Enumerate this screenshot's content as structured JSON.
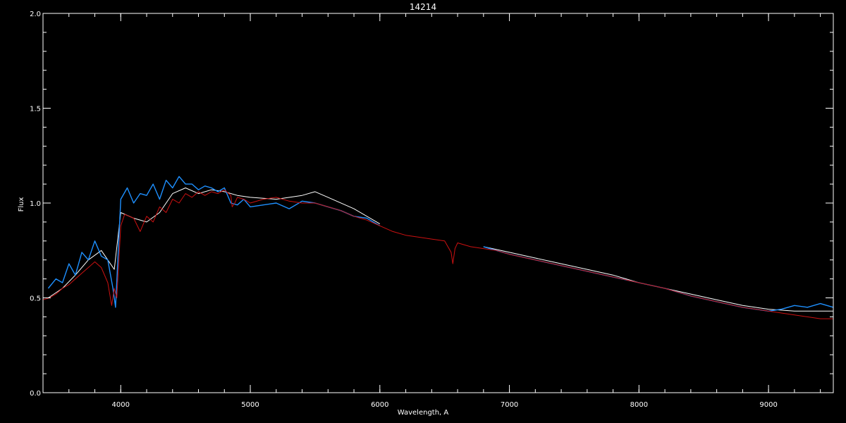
{
  "chart_data": {
    "type": "line",
    "title": "14214",
    "xlabel": "Wavelength, A",
    "ylabel": "Flux",
    "xlim": [
      3400,
      9500
    ],
    "ylim": [
      0.0,
      2.0
    ],
    "grid": false,
    "x_ticks": [
      4000,
      5000,
      6000,
      7000,
      8000,
      9000
    ],
    "y_ticks": [
      0.0,
      0.5,
      1.0,
      1.5,
      2.0
    ],
    "x_tick_labels": [
      "4000",
      "5000",
      "6000",
      "7000",
      "8000",
      "9000"
    ],
    "y_tick_labels": [
      "0.0",
      "0.5",
      "1.0",
      "1.5",
      "2.0"
    ],
    "x_minor_step": 200,
    "y_minor_step": 0.1,
    "series": [
      {
        "color": "#ffffff",
        "segments": [
          {
            "x": [
              3440,
              3550,
              3650,
              3750,
              3850,
              3950,
              4000,
              4100,
              4200,
              4300,
              4400,
              4500,
              4600,
              4700,
              4800,
              4900,
              5000,
              5200,
              5400,
              5500,
              5600,
              5800,
              6000
            ],
            "y": [
              0.5,
              0.55,
              0.62,
              0.7,
              0.75,
              0.65,
              0.95,
              0.92,
              0.9,
              0.95,
              1.05,
              1.08,
              1.05,
              1.07,
              1.06,
              1.04,
              1.03,
              1.02,
              1.04,
              1.06,
              1.03,
              0.97,
              0.89
            ]
          },
          {
            "x": [
              6800,
              7000,
              7200,
              7400,
              7600,
              7800,
              8000,
              8200,
              8400,
              8600,
              8800,
              9000,
              9200,
              9500
            ],
            "y": [
              0.77,
              0.74,
              0.71,
              0.68,
              0.65,
              0.62,
              0.58,
              0.55,
              0.52,
              0.49,
              0.46,
              0.44,
              0.43,
              0.43
            ]
          }
        ]
      },
      {
        "color": "#1e90ff",
        "segments": [
          {
            "x": [
              3440,
              3500,
              3550,
              3600,
              3650,
              3700,
              3750,
              3800,
              3850,
              3900,
              3940,
              3960,
              4000,
              4050,
              4100,
              4150,
              4200,
              4250,
              4300,
              4350,
              4400,
              4450,
              4500,
              4550,
              4600,
              4650,
              4700,
              4750,
              4800,
              4850,
              4900,
              4950,
              5000,
              5100,
              5200,
              5300,
              5400,
              5500,
              5600,
              5700,
              5800,
              5900,
              6000
            ],
            "y": [
              0.55,
              0.6,
              0.58,
              0.68,
              0.62,
              0.74,
              0.7,
              0.8,
              0.72,
              0.7,
              0.55,
              0.45,
              1.02,
              1.08,
              1.0,
              1.05,
              1.04,
              1.1,
              1.02,
              1.12,
              1.08,
              1.14,
              1.1,
              1.1,
              1.07,
              1.09,
              1.08,
              1.06,
              1.08,
              1.0,
              0.99,
              1.02,
              0.98,
              0.99,
              1.0,
              0.97,
              1.01,
              1.0,
              0.98,
              0.96,
              0.93,
              0.92,
              0.88
            ]
          },
          {
            "x": [
              6800,
              6900,
              7000,
              7200,
              7400,
              7600,
              7800,
              8000,
              8200,
              8400,
              8600,
              8800,
              9000,
              9100,
              9200,
              9300,
              9400,
              9500
            ],
            "y": [
              0.77,
              0.75,
              0.73,
              0.7,
              0.67,
              0.64,
              0.61,
              0.58,
              0.55,
              0.51,
              0.48,
              0.45,
              0.43,
              0.44,
              0.46,
              0.45,
              0.47,
              0.45
            ]
          }
        ]
      },
      {
        "color": "#cc1111",
        "segments": [
          {
            "x": [
              3400,
              3450,
              3500,
              3550,
              3600,
              3650,
              3700,
              3750,
              3800,
              3850,
              3900,
              3930,
              3950,
              3970,
              4000,
              4030,
              4100,
              4150,
              4200,
              4250,
              4300,
              4350,
              4400,
              4450,
              4500,
              4550,
              4600,
              4650,
              4700,
              4750,
              4800,
              4850,
              4860,
              4880,
              4900,
              4950,
              5000,
              5100,
              5200,
              5300,
              5400,
              5500,
              5600,
              5700,
              5800,
              5900,
              6000,
              6100,
              6200,
              6300,
              6400,
              6500,
              6550,
              6563,
              6580,
              6600,
              6700,
              6800,
              6900,
              7000,
              7200,
              7400,
              7600,
              7800,
              8000,
              8200,
              8400,
              8600,
              8800,
              9000,
              9100,
              9200,
              9300,
              9400,
              9500
            ],
            "y": [
              0.49,
              0.5,
              0.52,
              0.55,
              0.57,
              0.6,
              0.63,
              0.66,
              0.69,
              0.66,
              0.58,
              0.46,
              0.55,
              0.5,
              0.88,
              0.94,
              0.92,
              0.85,
              0.93,
              0.9,
              0.98,
              0.95,
              1.02,
              1.0,
              1.05,
              1.03,
              1.06,
              1.04,
              1.06,
              1.05,
              1.07,
              1.04,
              0.98,
              1.0,
              1.03,
              1.02,
              1.0,
              1.02,
              1.03,
              1.01,
              1.0,
              1.0,
              0.98,
              0.96,
              0.93,
              0.91,
              0.88,
              0.85,
              0.83,
              0.82,
              0.81,
              0.8,
              0.74,
              0.68,
              0.76,
              0.79,
              0.77,
              0.76,
              0.75,
              0.73,
              0.7,
              0.67,
              0.64,
              0.61,
              0.58,
              0.55,
              0.51,
              0.48,
              0.45,
              0.43,
              0.42,
              0.41,
              0.4,
              0.39,
              0.39
            ]
          }
        ]
      }
    ]
  }
}
